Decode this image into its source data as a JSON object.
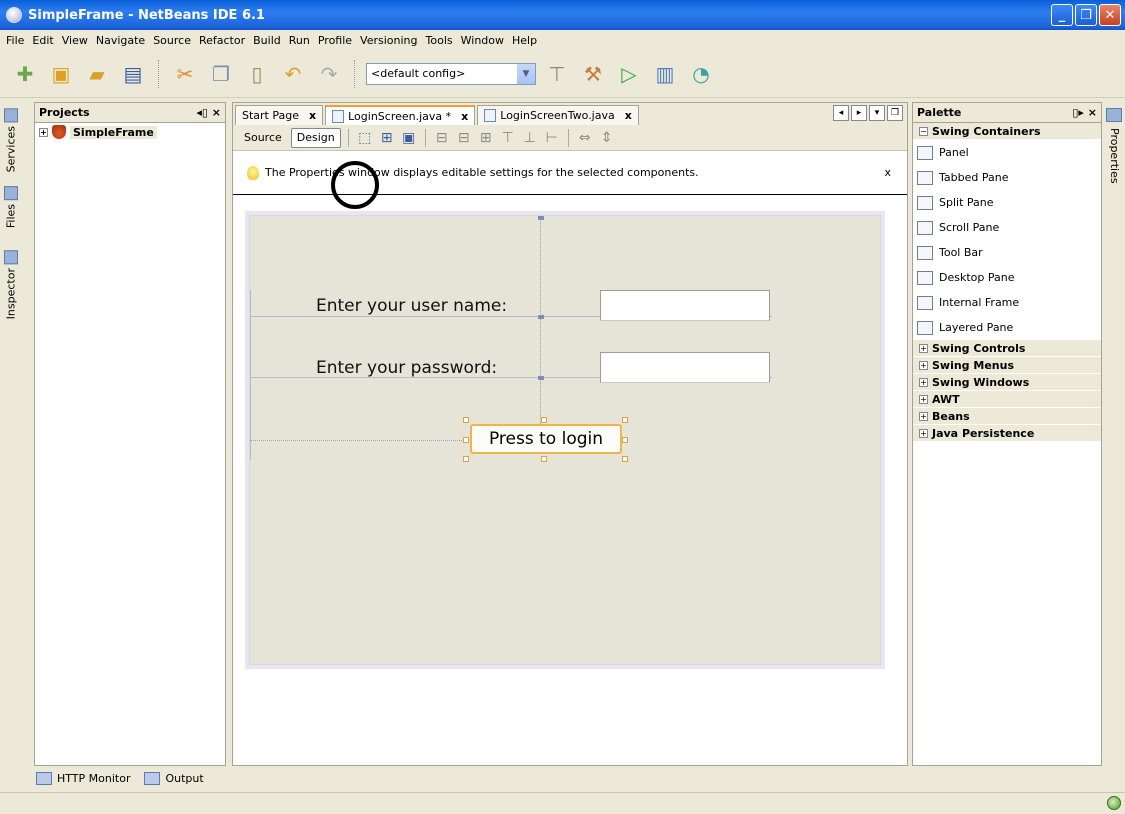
{
  "window": {
    "title": "SimpleFrame - NetBeans IDE 6.1",
    "minimize": "_",
    "maximize": "❐",
    "close": "✕"
  },
  "menu": [
    "File",
    "Edit",
    "View",
    "Navigate",
    "Source",
    "Refactor",
    "Build",
    "Run",
    "Profile",
    "Versioning",
    "Tools",
    "Window",
    "Help"
  ],
  "toolbar": {
    "config": "<default config>"
  },
  "left_tabs": {
    "services": "Services",
    "files": "Files",
    "inspector": "Inspector"
  },
  "projects": {
    "header": "Projects",
    "controls": "◂▯ ×",
    "root": "SimpleFrame"
  },
  "editor": {
    "tabs": [
      {
        "label": "Start Page",
        "close": "x"
      },
      {
        "label": "LoginScreen.java *",
        "close": "x"
      },
      {
        "label": "LoginScreenTwo.java",
        "close": "x"
      }
    ],
    "source_label": "Source",
    "design_label": "Design",
    "hint": "The Properties window displays editable settings for the selected components.",
    "hint_close": "x"
  },
  "form": {
    "username_label": "Enter your user name:",
    "password_label": "Enter your password:",
    "username_value": "",
    "password_value": "",
    "login_button": "Press to login"
  },
  "palette": {
    "header": "Palette",
    "controls": "▯▸ ×",
    "open_category": "Swing Containers",
    "items": [
      "Panel",
      "Tabbed Pane",
      "Split Pane",
      "Scroll Pane",
      "Tool Bar",
      "Desktop Pane",
      "Internal Frame",
      "Layered Pane"
    ],
    "categories": [
      "Swing Controls",
      "Swing Menus",
      "Swing Windows",
      "AWT",
      "Beans",
      "Java Persistence"
    ]
  },
  "right_tabs": {
    "properties": "Properties"
  },
  "bottom": {
    "http_monitor": "HTTP Monitor",
    "output": "Output"
  }
}
